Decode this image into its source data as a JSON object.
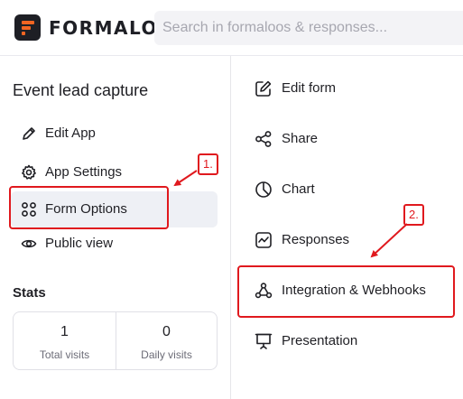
{
  "brand": {
    "name": "FORMALOO",
    "accent": "#f26522",
    "mark_color": "#1e1f25"
  },
  "search": {
    "placeholder": "Search in formaloos & responses...",
    "value": ""
  },
  "sidebar": {
    "app_title": "Event lead capture",
    "items": [
      {
        "label": "Edit App",
        "icon": "pencil-icon",
        "active": false
      },
      {
        "label": "App Settings",
        "icon": "gear-icon",
        "active": false
      },
      {
        "label": "Form Options",
        "icon": "grid-icon",
        "active": true
      },
      {
        "label": "Public view",
        "icon": "eye-icon",
        "active": false
      }
    ],
    "stats": {
      "heading": "Stats",
      "total_visits_value": "1",
      "total_visits_label": "Total visits",
      "daily_visits_value": "0",
      "daily_visits_label": "Daily visits"
    }
  },
  "form_menu": {
    "items": [
      {
        "label": "Edit form",
        "icon": "edit-form-icon"
      },
      {
        "label": "Share",
        "icon": "share-icon"
      },
      {
        "label": "Chart",
        "icon": "pie-chart-icon"
      },
      {
        "label": "Responses",
        "icon": "responses-icon"
      },
      {
        "label": "Integration & Webhooks",
        "icon": "webhook-icon"
      },
      {
        "label": "Presentation",
        "icon": "presentation-icon"
      }
    ]
  },
  "annotations": {
    "step1": "1.",
    "step2": "2.",
    "color": "#e0191e"
  }
}
